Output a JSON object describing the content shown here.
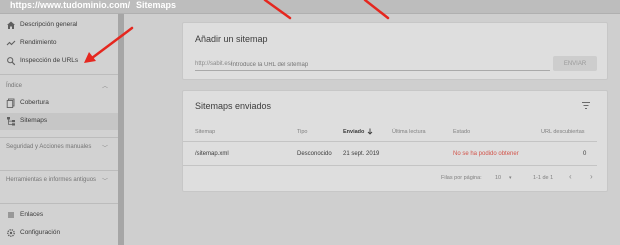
{
  "topbar": {
    "domain": "https://www.tudominio.com/",
    "title": "Sitemaps"
  },
  "sidebar": {
    "items_top": [
      {
        "label": "Descripción general",
        "icon": "home-icon"
      },
      {
        "label": "Rendimiento",
        "icon": "trend-icon"
      },
      {
        "label": "Inspección de URLs",
        "icon": "search-icon"
      }
    ],
    "section_index": "Índice",
    "items_index": [
      {
        "label": "Cobertura",
        "icon": "pages-icon"
      },
      {
        "label": "Sitemaps",
        "icon": "sitemap-icon"
      }
    ],
    "section_security": "Seguridad y Acciones manuales",
    "section_legacy": "Herramientas e informes antiguos",
    "items_bottom": [
      {
        "label": "Enlaces",
        "icon": "links-icon"
      },
      {
        "label": "Configuración",
        "icon": "gear-icon"
      }
    ]
  },
  "add_card": {
    "title": "Añadir un sitemap",
    "prefix": "http://sabit.es/",
    "placeholder": "Introduce la URL del sitemap",
    "button": "ENVIAR"
  },
  "sent_card": {
    "title": "Sitemaps enviados",
    "columns": [
      "Sitemap",
      "Tipo",
      "Enviado",
      "Última lectura",
      "Estado",
      "URL descubiertas"
    ],
    "sort_icon": "arrow-down-icon",
    "row": {
      "sitemap": "/sitemap.xml",
      "type": "Desconocido",
      "sent": "21 sept. 2019",
      "last_read": "",
      "status": "No se ha podido obtener",
      "urls": "0"
    },
    "footer": {
      "rows_label": "Filas por página:",
      "rows_value": "10",
      "range": "1-1 de 1"
    }
  },
  "colors": {
    "arrow": "#e5271f",
    "error": "#d2544a"
  }
}
